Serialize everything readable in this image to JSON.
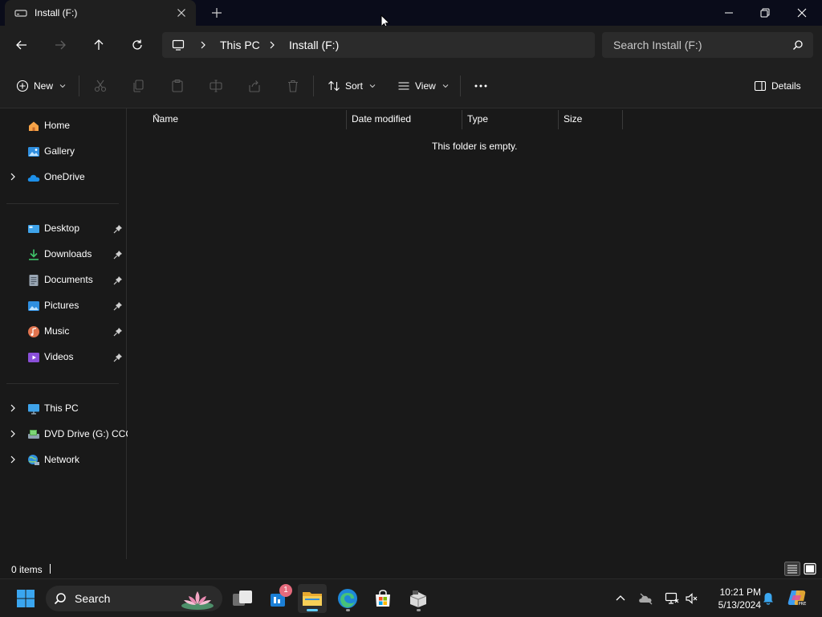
{
  "window": {
    "tab_title": "Install (F:)"
  },
  "address": {
    "crumbs": [
      "This PC",
      "Install (F:)"
    ]
  },
  "search": {
    "placeholder": "Search Install (F:)"
  },
  "commandbar": {
    "new_label": "New",
    "sort_label": "Sort",
    "view_label": "View",
    "details_label": "Details"
  },
  "sidebar": {
    "top": [
      {
        "label": "Home",
        "icon": "home-icon"
      },
      {
        "label": "Gallery",
        "icon": "gallery-icon"
      },
      {
        "label": "OneDrive",
        "icon": "onedrive-icon"
      }
    ],
    "pinned": [
      {
        "label": "Desktop",
        "icon": "desktop-icon"
      },
      {
        "label": "Downloads",
        "icon": "downloads-icon"
      },
      {
        "label": "Documents",
        "icon": "documents-icon"
      },
      {
        "label": "Pictures",
        "icon": "pictures-icon"
      },
      {
        "label": "Music",
        "icon": "music-icon"
      },
      {
        "label": "Videos",
        "icon": "videos-icon"
      }
    ],
    "devices": [
      {
        "label": "This PC",
        "icon": "this-pc-icon"
      },
      {
        "label": "DVD Drive (G:) CCC",
        "icon": "dvd-drive-icon"
      },
      {
        "label": "Network",
        "icon": "network-icon"
      }
    ]
  },
  "content": {
    "columns": [
      "Name",
      "Date modified",
      "Type",
      "Size"
    ],
    "empty_message": "This folder is empty."
  },
  "status": {
    "item_count": "0 items"
  },
  "taskbar": {
    "search_label": "Search",
    "store_badge": "1",
    "time": "10:21 PM",
    "date": "5/13/2024"
  },
  "colors": {
    "background": "#191919",
    "chrome": "#1f1f1f",
    "accent": "#60cdff"
  }
}
